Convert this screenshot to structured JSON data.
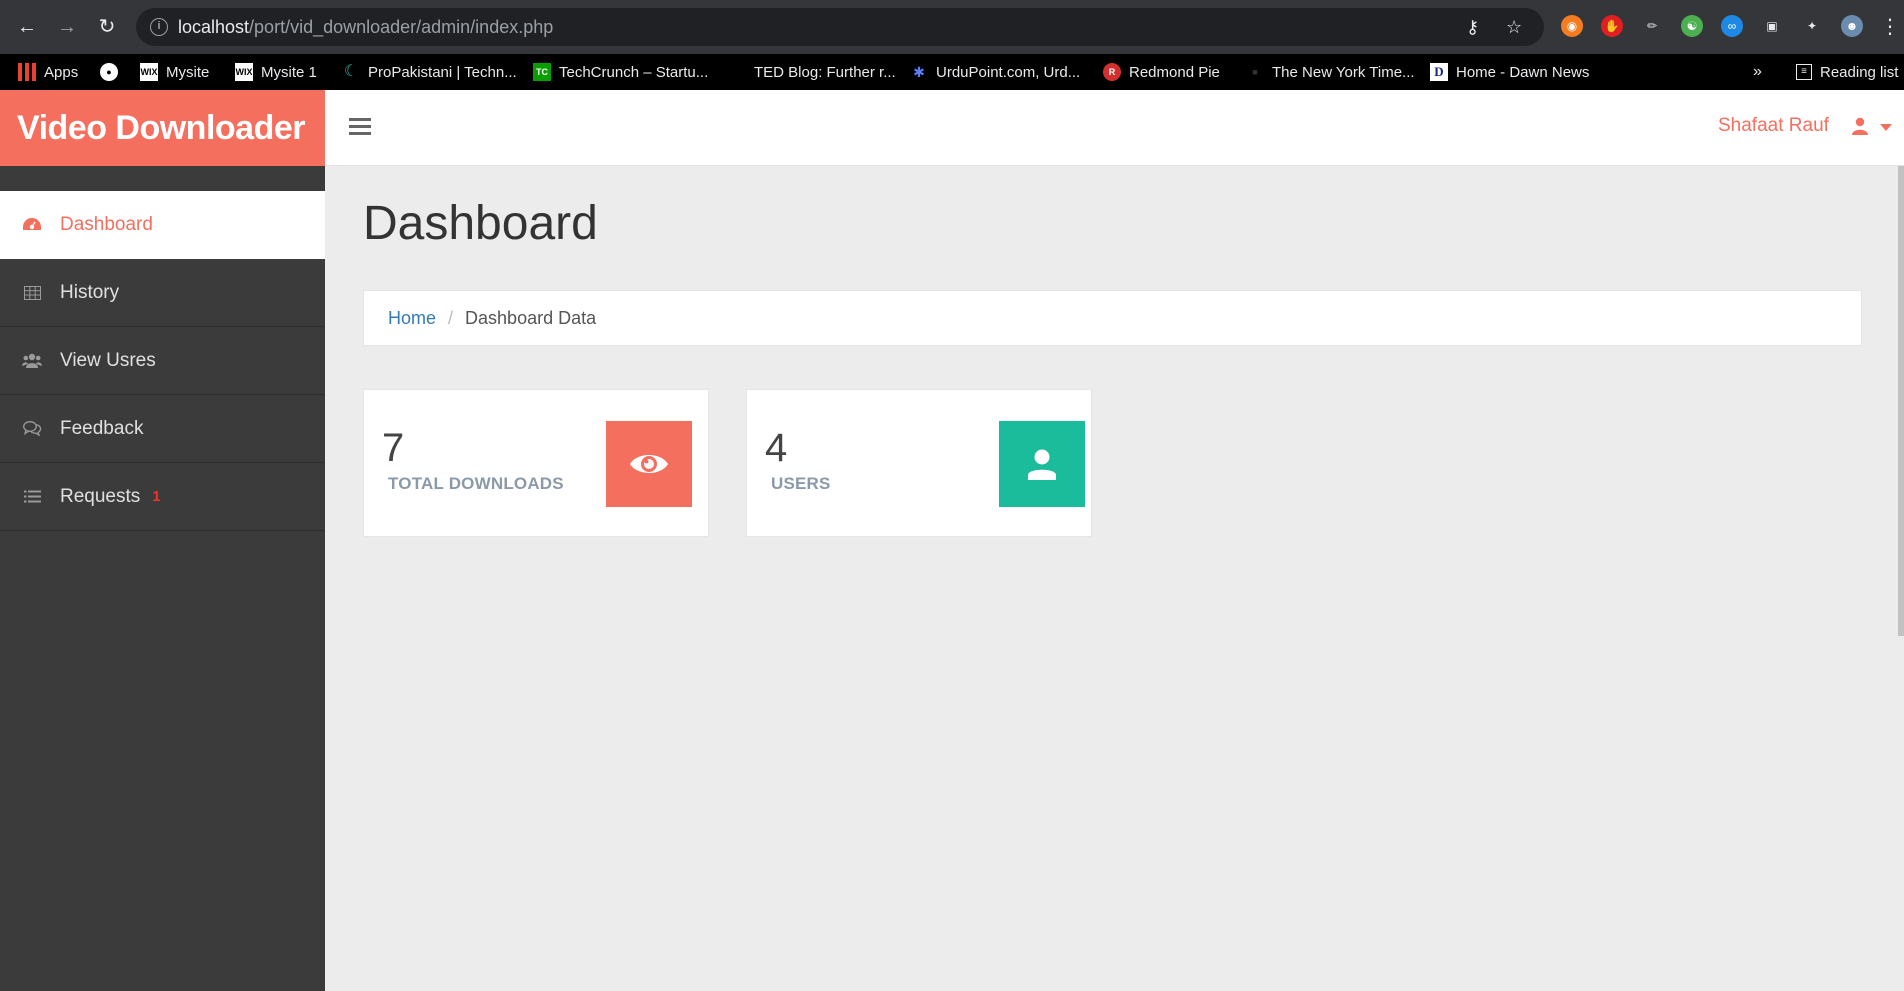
{
  "browser": {
    "url_host": "localhost",
    "url_path": "/port/vid_downloader/admin/index.php",
    "bookmarks": [
      {
        "label": "Apps",
        "icon": "apps-grid-icon"
      },
      {
        "label": "",
        "icon": "globe-icon"
      },
      {
        "label": "Mysite",
        "icon": "wix-icon"
      },
      {
        "label": "Mysite 1",
        "icon": "wix-icon"
      },
      {
        "label": "ProPakistani | Techn...",
        "icon": "propakistani-icon"
      },
      {
        "label": "TechCrunch – Startu...",
        "icon": "techcrunch-icon"
      },
      {
        "label": "TED Blog: Further r...",
        "icon": "ted-icon"
      },
      {
        "label": "UrduPoint.com, Urd...",
        "icon": "urdupoint-icon"
      },
      {
        "label": "Redmond Pie",
        "icon": "redmondpie-icon"
      },
      {
        "label": "The New York Time...",
        "icon": "nyt-icon"
      },
      {
        "label": "Home - Dawn News",
        "icon": "dawn-icon"
      }
    ],
    "overflow": "»",
    "reading_list": "Reading list"
  },
  "app": {
    "brand": "Video Downloader",
    "user_name": "Shafaat Rauf",
    "accent_color": "#f56f5e",
    "teal_color": "#1abc9c"
  },
  "sidebar": {
    "items": [
      {
        "label": "Dashboard",
        "icon": "dashboard-icon",
        "active": true
      },
      {
        "label": "History",
        "icon": "table-icon"
      },
      {
        "label": "View Usres",
        "icon": "users-icon"
      },
      {
        "label": "Feedback",
        "icon": "comments-icon"
      },
      {
        "label": "Requests",
        "icon": "list-icon",
        "badge": "1"
      }
    ]
  },
  "main": {
    "title": "Dashboard",
    "breadcrumb": {
      "home": "Home",
      "separator": "/",
      "current": "Dashboard Data"
    },
    "cards": [
      {
        "value": "7",
        "label": "TOTAL DOWNLOADS",
        "icon": "eye-icon"
      },
      {
        "value": "4",
        "label": "USERS",
        "icon": "user-icon"
      }
    ]
  }
}
